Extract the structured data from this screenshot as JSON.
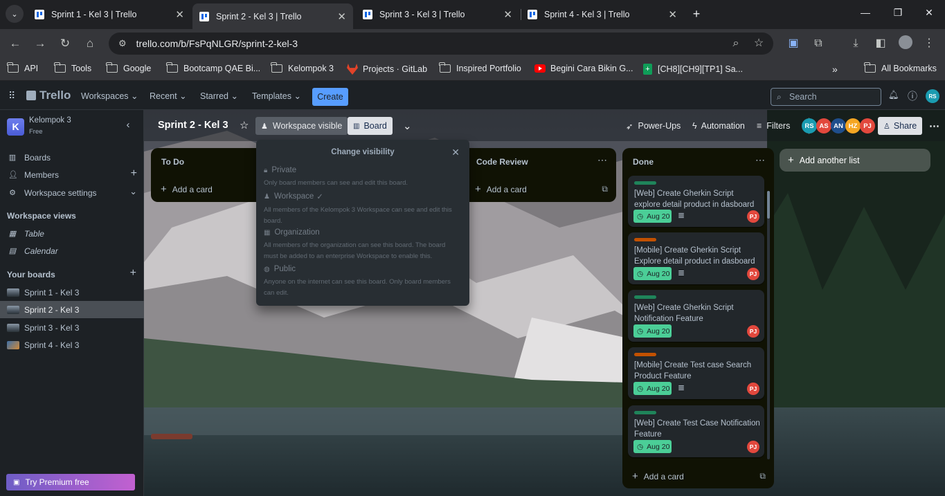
{
  "browser": {
    "tabs": [
      {
        "title": "Sprint 1 - Kel 3 | Trello",
        "active": false
      },
      {
        "title": "Sprint 2 - Kel 3 | Trello",
        "active": true
      },
      {
        "title": "Sprint 3 - Kel 3 | Trello",
        "active": false
      },
      {
        "title": "Sprint 4 - Kel 3 | Trello",
        "active": false
      }
    ],
    "url": "trello.com/b/FsPqNLGR/sprint-2-kel-3",
    "bookmarks": [
      {
        "label": "API",
        "icon": "folder-icon"
      },
      {
        "label": "Tools",
        "icon": "folder-icon"
      },
      {
        "label": "Google",
        "icon": "folder-icon"
      },
      {
        "label": "Bootcamp QAE Bi...",
        "icon": "folder-icon"
      },
      {
        "label": "Kelompok 3",
        "icon": "folder-icon"
      },
      {
        "label": "Projects · GitLab",
        "icon": "gitlab-icon"
      },
      {
        "label": "Inspired Portfolio",
        "icon": "folder-icon"
      },
      {
        "label": "Begini Cara Bikin G...",
        "icon": "youtube-icon"
      },
      {
        "label": "[CH8][CH9][TP1] Sa...",
        "icon": "sheets-icon"
      }
    ],
    "all_bookmarks": "All Bookmarks"
  },
  "trello": {
    "logo": "Trello",
    "nav": [
      "Workspaces",
      "Recent",
      "Starred",
      "Templates"
    ],
    "create": "Create",
    "search_placeholder": "Search",
    "user_initials": "RS"
  },
  "sidebar": {
    "workspace_name": "Kelompok 3",
    "workspace_initial": "K",
    "plan": "Free",
    "items": [
      {
        "label": "Boards",
        "icon": "board-icon"
      },
      {
        "label": "Members",
        "icon": "members-icon"
      },
      {
        "label": "Workspace settings",
        "icon": "gear-icon"
      }
    ],
    "views_heading": "Workspace views",
    "views": [
      {
        "label": "Table",
        "icon": "table-icon"
      },
      {
        "label": "Calendar",
        "icon": "calendar-icon"
      }
    ],
    "boards_heading": "Your boards",
    "boards": [
      {
        "label": "Sprint 1 - Kel 3",
        "active": false
      },
      {
        "label": "Sprint 2 - Kel 3",
        "active": true
      },
      {
        "label": "Sprint 3 - Kel 3",
        "active": false
      },
      {
        "label": "Sprint 4 - Kel 3",
        "active": false
      }
    ],
    "premium": "Try Premium free"
  },
  "board": {
    "title": "Sprint 2 - Kel 3",
    "visibility": "Workspace visible",
    "view": "Board",
    "powerups": "Power-Ups",
    "automation": "Automation",
    "filters": "Filters",
    "members": [
      {
        "initials": "RS",
        "color": "#1a9bb0"
      },
      {
        "initials": "AS",
        "color": "#e2483d"
      },
      {
        "initials": "AN",
        "color": "#1f4e8c"
      },
      {
        "initials": "HZ",
        "color": "#f5a623"
      },
      {
        "initials": "PJ",
        "color": "#e2483d"
      }
    ],
    "share": "Share",
    "add_list": "Add another list"
  },
  "lists": {
    "todo": {
      "title": "To Do",
      "add_card": "Add a card"
    },
    "code_review": {
      "title": "Code Review",
      "add_card": "Add a card"
    },
    "done": {
      "title": "Done",
      "add_card": "Add a card",
      "cards": [
        {
          "label_color": "#1f845a",
          "title": "[Web] Create Gherkin Script explore detail product in dasboard",
          "due": "Aug 20",
          "member": "PJ"
        },
        {
          "label_color": "#c25100",
          "title": "[Mobile] Create Gherkin Script Explore detail product in dasboard",
          "due": "Aug 20",
          "member": "PJ"
        },
        {
          "label_color": "#1f845a",
          "title": "[Web] Create Gherkin Script Notification Feature",
          "due": "Aug 20",
          "member": "PJ"
        },
        {
          "label_color": "#c25100",
          "title": "[Mobile] Create Test case Search Product Feature",
          "due": "Aug 20",
          "member": "PJ"
        },
        {
          "label_color": "#1f845a",
          "title": "[Web] Create Test Case Notification Feature",
          "due": "Aug 20",
          "member": "PJ"
        }
      ]
    }
  },
  "visibility_popover": {
    "title": "Change visibility",
    "options": [
      {
        "name": "Private",
        "desc": "Only board members can see and edit this board.",
        "icon": "lock-icon",
        "selected": false
      },
      {
        "name": "Workspace",
        "desc": "All members of the Kelompok 3 Workspace can see and edit this board.",
        "icon": "people-icon",
        "selected": true
      },
      {
        "name": "Organization",
        "desc": "All members of the organization can see this board. The board must be added to an enterprise Workspace to enable this.",
        "icon": "org-icon",
        "selected": false
      },
      {
        "name": "Public",
        "desc": "Anyone on the internet can see this board. Only board members can edit.",
        "icon": "globe-icon",
        "selected": false
      }
    ]
  }
}
